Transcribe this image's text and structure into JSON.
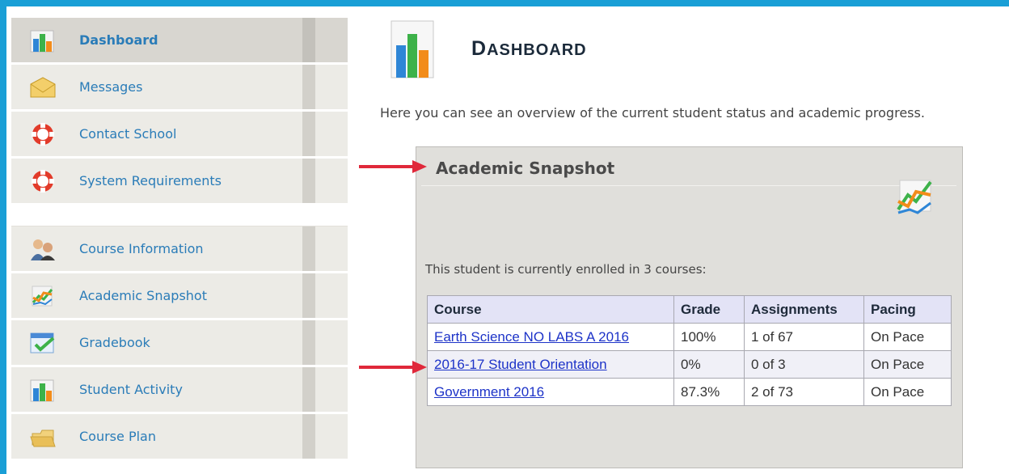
{
  "sidebar": {
    "items": [
      {
        "label": "Dashboard",
        "icon": "bar-chart-icon",
        "active": true
      },
      {
        "label": "Messages",
        "icon": "envelope-icon"
      },
      {
        "label": "Contact School",
        "icon": "lifebuoy-icon"
      },
      {
        "label": "System Requirements",
        "icon": "lifebuoy-icon"
      },
      {
        "label": "Course Information",
        "icon": "people-icon"
      },
      {
        "label": "Academic Snapshot",
        "icon": "line-chart-icon"
      },
      {
        "label": "Gradebook",
        "icon": "checkmark-icon"
      },
      {
        "label": "Student Activity",
        "icon": "bar-chart-icon"
      },
      {
        "label": "Course Plan",
        "icon": "folder-icon"
      }
    ]
  },
  "header": {
    "title_first": "D",
    "title_rest": "ASHBOARD",
    "intro": "Here you can see an overview of the current student status and academic progress."
  },
  "snapshot": {
    "title": "Academic Snapshot",
    "enrolled_text": "This student is currently enrolled in 3 courses:",
    "columns": [
      "Course",
      "Grade",
      "Assignments",
      "Pacing"
    ],
    "rows": [
      {
        "course": "Earth Science NO LABS A 2016",
        "grade": "100%",
        "assignments": "1 of 67",
        "pacing": "On Pace"
      },
      {
        "course": "2016-17 Student Orientation",
        "grade": "0%",
        "assignments": "0 of 3",
        "pacing": "On Pace"
      },
      {
        "course": "Government 2016",
        "grade": "87.3%",
        "assignments": "2 of 73",
        "pacing": "On Pace"
      }
    ]
  },
  "colors": {
    "frame": "#1a9fd6",
    "link": "#1d33c8",
    "nav_label": "#2a7cb8",
    "annotation_arrow": "#e0283a"
  }
}
